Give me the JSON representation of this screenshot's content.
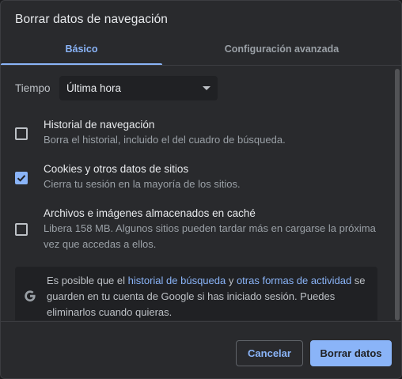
{
  "dialog": {
    "title": "Borrar datos de navegación"
  },
  "tabs": [
    {
      "label": "Básico",
      "active": true
    },
    {
      "label": "Configuración avanzada",
      "active": false
    }
  ],
  "time_range": {
    "label": "Tiempo",
    "selected": "Última hora"
  },
  "options": [
    {
      "title": "Historial de navegación",
      "description": "Borra el historial, incluido el del cuadro de búsqueda.",
      "checked": false
    },
    {
      "title": "Cookies y otros datos de sitios",
      "description": "Cierra tu sesión en la mayoría de los sitios.",
      "checked": true
    },
    {
      "title": "Archivos e imágenes almacenados en caché",
      "description": "Libera 158 MB. Algunos sitios pueden tardar más en cargarse la próxima vez que accedas a ellos.",
      "checked": false
    }
  ],
  "info": {
    "text_before": "Es posible que el ",
    "link1": "historial de búsqueda",
    "text_middle": " y ",
    "link2": "otras formas de actividad",
    "text_after": " se guarden en tu cuenta de Google si has iniciado sesión. Puedes eliminarlos cuando quieras.",
    "icon": "google-g-icon"
  },
  "buttons": {
    "cancel": "Cancelar",
    "clear": "Borrar datos"
  },
  "colors": {
    "accent": "#8ab4f8",
    "background": "#292a2d",
    "text": "#e8eaed",
    "secondary_text": "#9aa0a6"
  }
}
